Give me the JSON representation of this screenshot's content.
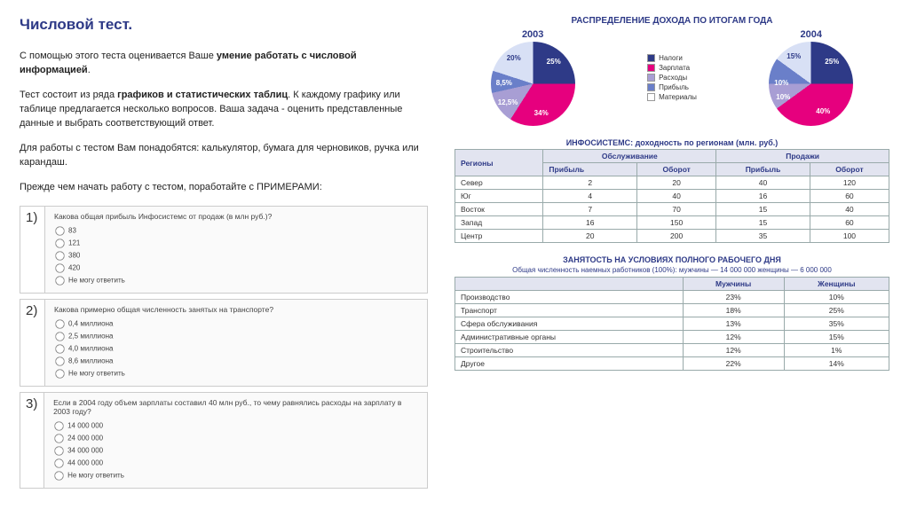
{
  "title": "Числовой тест.",
  "intro": {
    "p1_a": "С помощью этого теста оценивается Ваше ",
    "p1_b": "умение работать с числовой информацией",
    "p1_c": ".",
    "p2_a": "Тест состоит из ряда ",
    "p2_b": "графиков и статистических таблиц",
    "p2_c": ". К каждому графику или таблице предлагается несколько вопросов. Ваша задача - оценить представленные данные и выбрать соответствующий ответ.",
    "p3": "Для работы с тестом Вам понадобятся: калькулятор, бумага для черновиков, ручка или карандаш.",
    "p4": "Прежде чем начать работу с тестом, поработайте с ПРИМЕРАМИ:"
  },
  "questions": [
    {
      "n": "1)",
      "text": "Какова общая прибыль Инфосистемс от продаж (в млн руб.)?",
      "opts": [
        "83",
        "121",
        "380",
        "420",
        "Не могу ответить"
      ]
    },
    {
      "n": "2)",
      "text": "Какова примерно общая численность занятых на транспорте?",
      "opts": [
        "0,4 миллиона",
        "2,5 миллиона",
        "4,0 миллиона",
        "8,6 миллиона",
        "Не могу ответить"
      ]
    },
    {
      "n": "3)",
      "text": "Если в 2004 году объем зарплаты составил 40 млн руб., то чему равнялись расходы на зарплату в 2003 году?",
      "opts": [
        "14 000 000",
        "24 000 000",
        "34 000 000",
        "44 000 000",
        "Не могу ответить"
      ]
    }
  ],
  "pie_title": "РАСПРЕДЕЛЕНИЕ ДОХОДА ПО ИТОГАМ ГОДА",
  "pie_years": {
    "a": "2003",
    "b": "2004"
  },
  "legend": [
    {
      "c": "#2E3A87",
      "t": "Налоги"
    },
    {
      "c": "#E6007E",
      "t": "Зарплата"
    },
    {
      "c": "#A89ED4",
      "t": "Расходы"
    },
    {
      "c": "#6A7FC9",
      "t": "Прибыль"
    },
    {
      "c": "#FFFFFF",
      "t": "Материалы"
    }
  ],
  "chart_data": [
    {
      "type": "pie",
      "title": "2003",
      "series": [
        {
          "name": "Налоги",
          "value": 25
        },
        {
          "name": "Зарплата",
          "value": 34
        },
        {
          "name": "Расходы",
          "value": 12.5
        },
        {
          "name": "Прибыль",
          "value": 8.5
        },
        {
          "name": "Материалы",
          "value": 20
        }
      ]
    },
    {
      "type": "pie",
      "title": "2004",
      "series": [
        {
          "name": "Налоги",
          "value": 25
        },
        {
          "name": "Зарплата",
          "value": 40
        },
        {
          "name": "Расходы",
          "value": 10
        },
        {
          "name": "Прибыль",
          "value": 10
        },
        {
          "name": "Материалы",
          "value": 15
        }
      ]
    }
  ],
  "table1": {
    "title": "ИНФОСИСТЕМС: доходность по регионам (млн. руб.)",
    "h_region": "Регионы",
    "h_serv": "Обслуживание",
    "h_sales": "Продажи",
    "h_profit": "Прибыль",
    "h_turn": "Оборот",
    "rows": [
      {
        "r": "Север",
        "a": "2",
        "b": "20",
        "c": "40",
        "d": "120"
      },
      {
        "r": "Юг",
        "a": "4",
        "b": "40",
        "c": "16",
        "d": "60"
      },
      {
        "r": "Восток",
        "a": "7",
        "b": "70",
        "c": "15",
        "d": "40"
      },
      {
        "r": "Запад",
        "a": "16",
        "b": "150",
        "c": "15",
        "d": "60"
      },
      {
        "r": "Центр",
        "a": "20",
        "b": "200",
        "c": "35",
        "d": "100"
      }
    ]
  },
  "table2": {
    "title": "ЗАНЯТОСТЬ НА УСЛОВИЯХ ПОЛНОГО РАБОЧЕГО ДНЯ",
    "sub": "Общая численность наемных работников (100%):  мужчины — 14 000 000   женщины — 6 000 000",
    "h_m": "Мужчины",
    "h_f": "Женщины",
    "rows": [
      {
        "r": "Производство",
        "m": "23%",
        "f": "10%"
      },
      {
        "r": "Транспорт",
        "m": "18%",
        "f": "25%"
      },
      {
        "r": "Сфера обслуживания",
        "m": "13%",
        "f": "35%"
      },
      {
        "r": "Административные органы",
        "m": "12%",
        "f": "15%"
      },
      {
        "r": "Строительство",
        "m": "12%",
        "f": "1%"
      },
      {
        "r": "Другое",
        "m": "22%",
        "f": "14%"
      }
    ]
  }
}
